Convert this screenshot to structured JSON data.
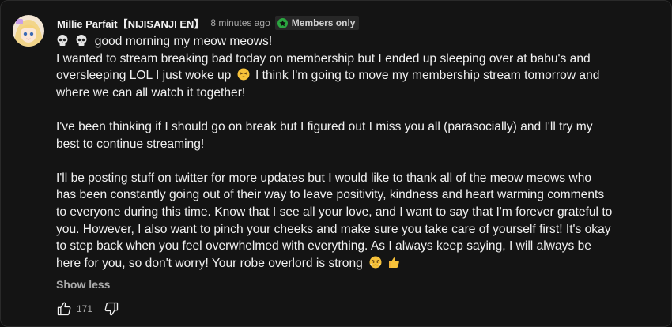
{
  "comment": {
    "author": "Millie Parfait【NIJISANJI EN】",
    "timestamp": "8 minutes ago",
    "badge_label": "Members only",
    "badge_color": "#2ba640",
    "lines": {
      "l1": "good morning my meow meows!",
      "l2": "I wanted to stream breaking bad today on membership but I ended up sleeping over at babu's and",
      "l3a": "oversleeping LOL I just woke up",
      "l3b": "I think I'm going to move my membership stream tomorrow and",
      "l4": "where we can all watch it together!",
      "l5": "I've been thinking if I should go on break but I figured out I miss you all (parasocially) and I'll try my",
      "l6": "best to continue streaming!",
      "l7": "I'll be posting stuff on twitter for more updates but I would like to thank all of the meow meows who",
      "l8": "has been constantly going out of their way to leave positivity, kindness and heart warming comments",
      "l9": "to everyone during this time. Know that I see all your love, and I want to say that I'm forever grateful to",
      "l10": "you. However, I also want to pinch your cheeks and make sure you take care of yourself first! It's okay",
      "l11": "to step back when you feel overwhelmed with everything. As I always keep saying, I will always be",
      "l12": "here for you, so don't worry! Your robe overlord is strong"
    },
    "emojis": [
      "skull",
      "skull",
      "tired-face",
      "pouting-face",
      "thumbs-up"
    ],
    "show_less_label": "Show less",
    "like_count": "171"
  }
}
